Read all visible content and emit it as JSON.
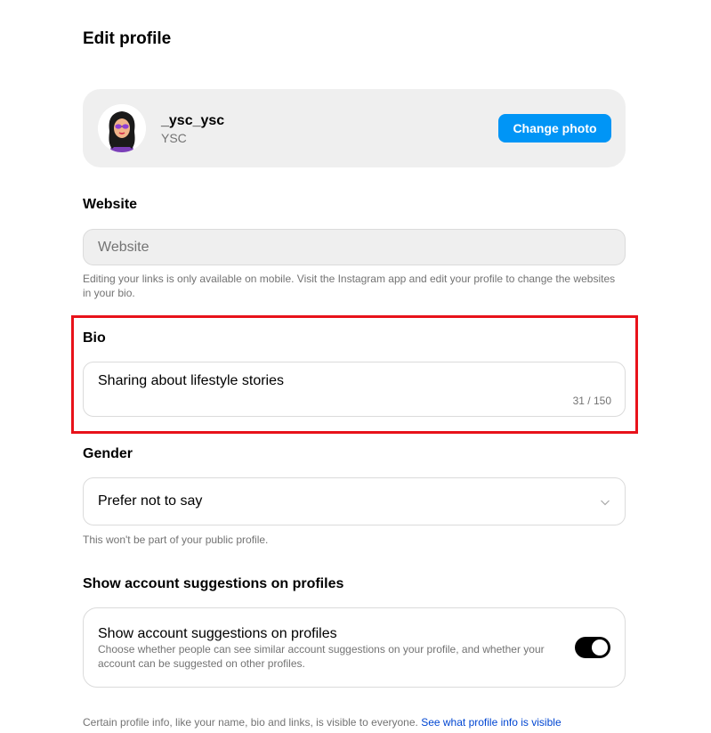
{
  "page": {
    "title": "Edit profile"
  },
  "profile": {
    "username": "_ysc_ysc",
    "full_name": "YSC",
    "change_photo_label": "Change photo"
  },
  "website": {
    "label": "Website",
    "placeholder": "Website",
    "value": "",
    "helper": "Editing your links is only available on mobile. Visit the Instagram app and edit your profile to change the websites in your bio."
  },
  "bio": {
    "label": "Bio",
    "value": "Sharing about lifestyle stories",
    "counter": "31 / 150"
  },
  "gender": {
    "label": "Gender",
    "selected": "Prefer not to say",
    "helper": "This won't be part of your public profile."
  },
  "suggestions": {
    "section_label": "Show account suggestions on profiles",
    "title": "Show account suggestions on profiles",
    "description": "Choose whether people can see similar account suggestions on your profile, and whether your account can be suggested on other profiles.",
    "toggle_on": true
  },
  "footer": {
    "text": "Certain profile info, like your name, bio and links, is visible to everyone.",
    "link_label": "See what profile info is visible"
  },
  "colors": {
    "primary_button": "#0095f6",
    "highlight_border": "#e8121a",
    "link": "#0046d2",
    "toggle_active": "#000000"
  },
  "icons": {
    "avatar": "avatar-illustration",
    "gender_dropdown": "chevron-down-icon"
  }
}
